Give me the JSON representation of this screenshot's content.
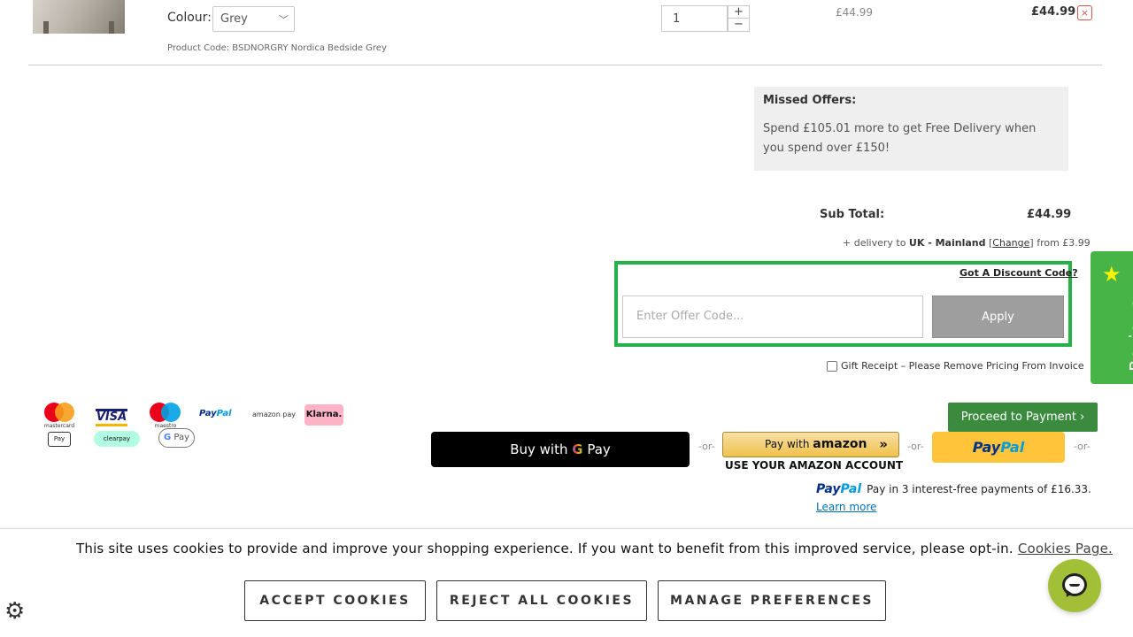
{
  "product": {
    "colour_label": "Colour:",
    "colour_value": "Grey",
    "code": "Product Code: BSDNORGRY Nordica Bedside Grey",
    "qty": "1",
    "qty_plus": "+",
    "qty_minus": "−",
    "unit_price": "£44.99",
    "line_total": "£44.99",
    "remove": "×"
  },
  "missed_offers": {
    "title": "Missed Offers:",
    "text": "Spend £105.01 more to get Free Delivery when you spend over £150!"
  },
  "summary": {
    "subtotal_label": "Sub Total:",
    "subtotal_value": "£44.99",
    "delivery_prefix": "+ delivery to ",
    "delivery_region": "UK - Mainland",
    "delivery_bracket_open": " [",
    "delivery_change": "Change",
    "delivery_suffix": "] from £3.99"
  },
  "discount": {
    "link": "Got A Discount Code?",
    "placeholder": "Enter Offer Code...",
    "apply": "Apply",
    "highlight_color": "#25b14a"
  },
  "gift": {
    "label": "Gift Receipt – Please Remove Pricing From Invoice"
  },
  "payment_logos": {
    "mastercard": "mastercard",
    "visa": "VISA",
    "maestro": "maestro",
    "paypal_a": "Pay",
    "paypal_b": "Pal",
    "amazonpay": "amazon pay",
    "klarna": "Klarna.",
    "applepay": "Pay",
    "clearpay": "clearpay",
    "gpay": "Pay"
  },
  "buttons": {
    "proceed": "Proceed to Payment ›",
    "buy_with": "Buy with ",
    "gpay_g": "G",
    "gpay_pay": " Pay",
    "or": "-or-",
    "amazon_pay_with": "Pay with ",
    "amazon_brand": "amazon",
    "amazon_arrows": "»",
    "amazon_sub": "USE YOUR AMAZON ACCOUNT",
    "paypal_a": "Pay",
    "paypal_b": "Pal"
  },
  "paypal_credit": {
    "mark_a": "Pay",
    "mark_b": "Pal",
    "text": "Pay in 3 interest-free payments of £16.33.",
    "learn_more": "Learn more"
  },
  "reviews_tab": {
    "label": "Reviews",
    "star": "★"
  },
  "cookie": {
    "text": "This site uses cookies to provide and improve your shopping experience. If you want to benefit from this improved service, please opt-in. ",
    "link": "Cookies Page.",
    "accept": "ACCEPT COOKIES",
    "reject": "REJECT ALL COOKIES",
    "manage": "MANAGE PREFERENCES",
    "gear": "⚙"
  },
  "colors": {
    "proceed_green": "#3b8b3f",
    "reviews_green": "#46b447",
    "paypal_yellow": "#ffc439",
    "chat_green": "#a2c037"
  }
}
